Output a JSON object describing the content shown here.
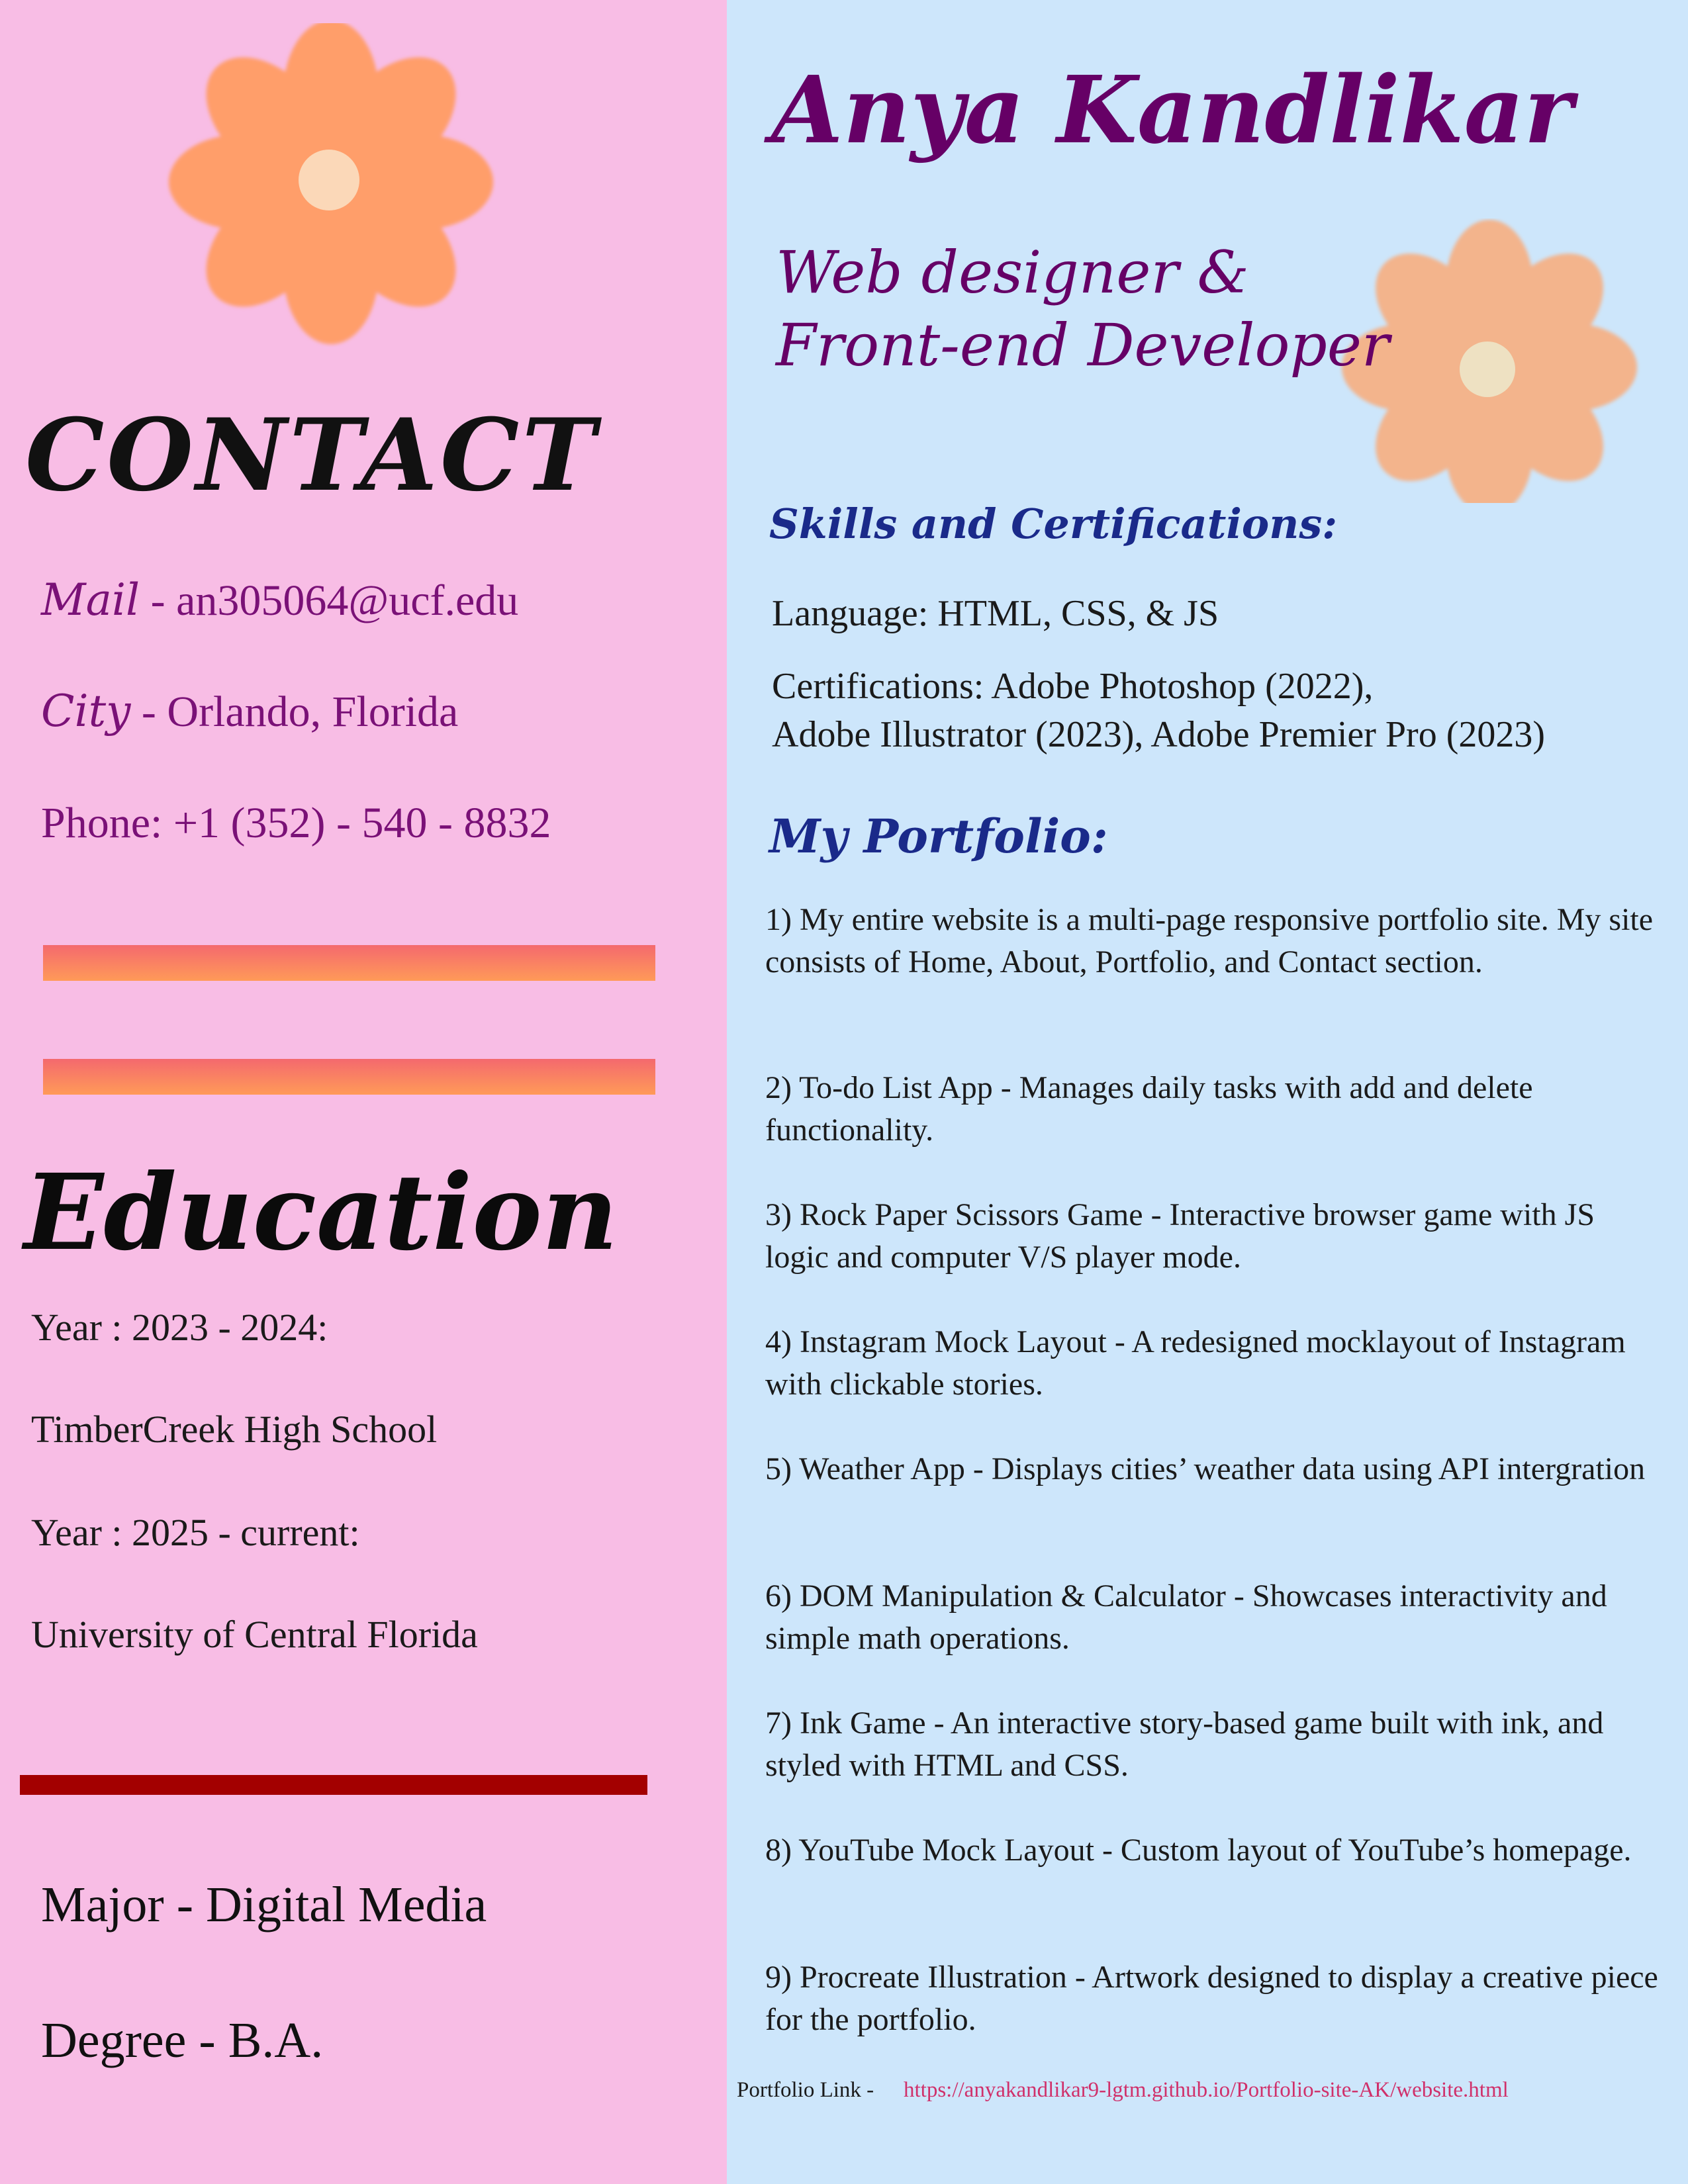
{
  "colors": {
    "left_bg": "#f8bde5",
    "right_bg": "#cde6fb",
    "accent_purple": "#660066",
    "heading_blue": "#1a2a8a",
    "link_pink": "#d0306a",
    "divider_red": "#a30000"
  },
  "header": {
    "name": "Anya Kandlikar",
    "title_line1": "Web designer &",
    "title_line2": "Front-end Developer"
  },
  "contact": {
    "heading": "CONTACT",
    "mail_label": "Mail",
    "mail_value": " - an305064@ucf.edu",
    "city_label": "City",
    "city_value": " - Orlando, Florida",
    "phone": "Phone: +1 (352) - 540 - 8832"
  },
  "education": {
    "heading": "Education",
    "year1": "Year : 2023 - 2024:",
    "school1": "TimberCreek High School",
    "year2": "Year :  2025 - current:",
    "school2": "University of Central Florida",
    "major": "Major - Digital Media",
    "degree": "Degree - B.A."
  },
  "skills": {
    "heading": "Skills and Certifications:",
    "language": "Language: HTML, CSS, & JS",
    "cert_line1": "Certifications: Adobe Photoshop (2022),",
    "cert_line2": "Adobe Illustrator (2023), Adobe Premier Pro (2023)"
  },
  "portfolio": {
    "heading": "My Portfolio:",
    "items": [
      "1)  My entire website is a multi-page responsive portfolio site. My site consists of Home, About, Portfolio, and Contact section.",
      "2) To-do List App - Manages daily tasks with add and delete functionality.",
      "3) Rock Paper Scissors Game - Interactive browser game with JS logic and computer V/S player mode.",
      "4) Instagram Mock Layout -  A redesigned mocklayout of Instagram with clickable stories.",
      "5) Weather App - Displays cities’ weather data using API intergration",
      "6) DOM Manipulation & Calculator - Showcases interactivity and simple math operations.",
      "7) Ink Game - An interactive story-based game built with ink, and styled with HTML and CSS.",
      "8) YouTube Mock Layout - Custom layout of YouTube’s homepage.",
      "9) Procreate Illustration - Artwork designed to display a creative piece for the portfolio."
    ],
    "link_label": "Portfolio Link -",
    "link_url": "https://anyakandlikar9-lgtm.github.io/Portfolio-site-AK/website.html"
  },
  "icons": [
    "flower-icon",
    "flower-icon"
  ]
}
